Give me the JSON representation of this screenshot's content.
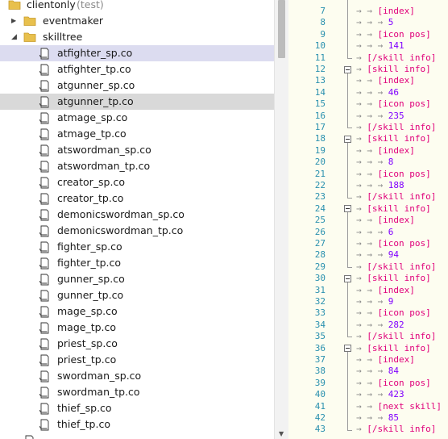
{
  "tree": {
    "root": {
      "label": "clientonly",
      "suffix": "(test)"
    },
    "folders": [
      {
        "label": "eventmaker",
        "expanded": false
      },
      {
        "label": "skilltree",
        "expanded": true
      }
    ],
    "files": [
      {
        "label": "atfighter_sp.co",
        "state": "selected"
      },
      {
        "label": "atfighter_tp.co",
        "state": ""
      },
      {
        "label": "atgunner_sp.co",
        "state": ""
      },
      {
        "label": "atgunner_tp.co",
        "state": "hover"
      },
      {
        "label": "atmage_sp.co",
        "state": ""
      },
      {
        "label": "atmage_tp.co",
        "state": ""
      },
      {
        "label": "atswordman_sp.co",
        "state": ""
      },
      {
        "label": "atswordman_tp.co",
        "state": ""
      },
      {
        "label": "creator_sp.co",
        "state": ""
      },
      {
        "label": "creator_tp.co",
        "state": ""
      },
      {
        "label": "demonicswordman_sp.co",
        "state": ""
      },
      {
        "label": "demonicswordman_tp.co",
        "state": ""
      },
      {
        "label": "fighter_sp.co",
        "state": ""
      },
      {
        "label": "fighter_tp.co",
        "state": ""
      },
      {
        "label": "gunner_sp.co",
        "state": ""
      },
      {
        "label": "gunner_tp.co",
        "state": ""
      },
      {
        "label": "mage_sp.co",
        "state": ""
      },
      {
        "label": "mage_tp.co",
        "state": ""
      },
      {
        "label": "priest_sp.co",
        "state": ""
      },
      {
        "label": "priest_tp.co",
        "state": ""
      },
      {
        "label": "swordman_sp.co",
        "state": ""
      },
      {
        "label": "swordman_tp.co",
        "state": ""
      },
      {
        "label": "thief_sp.co",
        "state": ""
      },
      {
        "label": "thief_tp.co",
        "state": ""
      }
    ]
  },
  "editor": {
    "lines": [
      {
        "n": "7",
        "fold": "line",
        "tabs": 1,
        "text": "[index]",
        "kind": "tag"
      },
      {
        "n": "8",
        "fold": "line",
        "tabs": 2,
        "text": "5",
        "kind": "num"
      },
      {
        "n": "9",
        "fold": "line",
        "tabs": 1,
        "text": "[icon pos]",
        "kind": "tag"
      },
      {
        "n": "10",
        "fold": "line",
        "tabs": 2,
        "text": "141",
        "kind": "num"
      },
      {
        "n": "11",
        "fold": "end",
        "tabs": 0,
        "text": "[/skill info]",
        "kind": "tag"
      },
      {
        "n": "12",
        "fold": "box",
        "tabs": 0,
        "text": "[skill info]",
        "kind": "tag"
      },
      {
        "n": "13",
        "fold": "line",
        "tabs": 1,
        "text": "[index]",
        "kind": "tag"
      },
      {
        "n": "14",
        "fold": "line",
        "tabs": 2,
        "text": "46",
        "kind": "num"
      },
      {
        "n": "15",
        "fold": "line",
        "tabs": 1,
        "text": "[icon pos]",
        "kind": "tag"
      },
      {
        "n": "16",
        "fold": "line",
        "tabs": 2,
        "text": "235",
        "kind": "num"
      },
      {
        "n": "17",
        "fold": "end",
        "tabs": 0,
        "text": "[/skill info]",
        "kind": "tag"
      },
      {
        "n": "18",
        "fold": "box",
        "tabs": 0,
        "text": "[skill info]",
        "kind": "tag"
      },
      {
        "n": "19",
        "fold": "line",
        "tabs": 1,
        "text": "[index]",
        "kind": "tag"
      },
      {
        "n": "20",
        "fold": "line",
        "tabs": 2,
        "text": "8",
        "kind": "num"
      },
      {
        "n": "21",
        "fold": "line",
        "tabs": 1,
        "text": "[icon pos]",
        "kind": "tag"
      },
      {
        "n": "22",
        "fold": "line",
        "tabs": 2,
        "text": "188",
        "kind": "num"
      },
      {
        "n": "23",
        "fold": "end",
        "tabs": 0,
        "text": "[/skill info]",
        "kind": "tag"
      },
      {
        "n": "24",
        "fold": "box",
        "tabs": 0,
        "text": "[skill info]",
        "kind": "tag"
      },
      {
        "n": "25",
        "fold": "line",
        "tabs": 1,
        "text": "[index]",
        "kind": "tag"
      },
      {
        "n": "26",
        "fold": "line",
        "tabs": 2,
        "text": "6",
        "kind": "num"
      },
      {
        "n": "27",
        "fold": "line",
        "tabs": 1,
        "text": "[icon pos]",
        "kind": "tag"
      },
      {
        "n": "28",
        "fold": "line",
        "tabs": 2,
        "text": "94",
        "kind": "num"
      },
      {
        "n": "29",
        "fold": "end",
        "tabs": 0,
        "text": "[/skill info]",
        "kind": "tag"
      },
      {
        "n": "30",
        "fold": "box",
        "tabs": 0,
        "text": "[skill info]",
        "kind": "tag"
      },
      {
        "n": "31",
        "fold": "line",
        "tabs": 1,
        "text": "[index]",
        "kind": "tag"
      },
      {
        "n": "32",
        "fold": "line",
        "tabs": 2,
        "text": "9",
        "kind": "num"
      },
      {
        "n": "33",
        "fold": "line",
        "tabs": 1,
        "text": "[icon pos]",
        "kind": "tag"
      },
      {
        "n": "34",
        "fold": "line",
        "tabs": 2,
        "text": "282",
        "kind": "num"
      },
      {
        "n": "35",
        "fold": "end",
        "tabs": 0,
        "text": "[/skill info]",
        "kind": "tag"
      },
      {
        "n": "36",
        "fold": "box",
        "tabs": 0,
        "text": "[skill info]",
        "kind": "tag"
      },
      {
        "n": "37",
        "fold": "line",
        "tabs": 1,
        "text": "[index]",
        "kind": "tag"
      },
      {
        "n": "38",
        "fold": "line",
        "tabs": 2,
        "text": "84",
        "kind": "num"
      },
      {
        "n": "39",
        "fold": "line",
        "tabs": 1,
        "text": "[icon pos]",
        "kind": "tag"
      },
      {
        "n": "40",
        "fold": "line",
        "tabs": 2,
        "text": "423",
        "kind": "num"
      },
      {
        "n": "41",
        "fold": "line",
        "tabs": 1,
        "text": "[next skill]",
        "kind": "tag"
      },
      {
        "n": "42",
        "fold": "line",
        "tabs": 2,
        "text": "85",
        "kind": "num"
      },
      {
        "n": "43",
        "fold": "end",
        "tabs": 0,
        "text": "[/skill info]",
        "kind": "tag"
      }
    ]
  },
  "colors": {
    "line_number": "#2b91af",
    "tag": "#e0007a",
    "number": "#8000ff",
    "editor_bg": "#fdfdf0",
    "selected_row": "#dcdcf0",
    "hover_row": "#d9d9d9",
    "folder": "#e8c04d"
  }
}
